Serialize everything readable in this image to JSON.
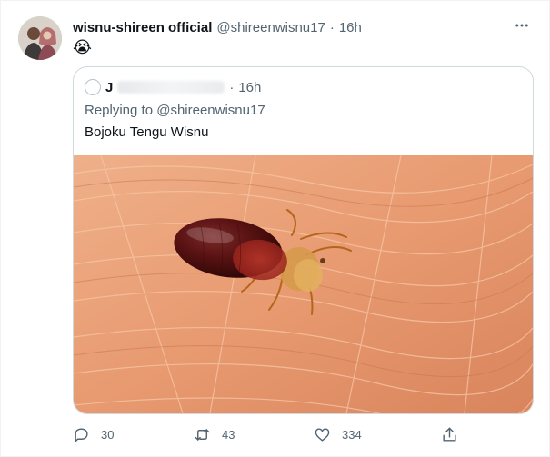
{
  "tweet": {
    "display_name": "wisnu-shireen official",
    "handle": "@shireenwisnu17",
    "separator": "·",
    "time": "16h",
    "text": "😭",
    "more_icon": "more-horizontal-icon"
  },
  "quoted_tweet": {
    "author_initial": "J",
    "separator": "·",
    "time": "16h",
    "replying_to": "Replying to @shireenwisnu17",
    "text": "Bojoku Tengu Wisnu",
    "image_description_icon": "photo-bedbug"
  },
  "actions": {
    "reply_count": "30",
    "retweet_count": "43",
    "like_count": "334"
  },
  "colors": {
    "text_primary": "#0f1419",
    "text_secondary": "#536471",
    "border": "#cfd9de"
  }
}
